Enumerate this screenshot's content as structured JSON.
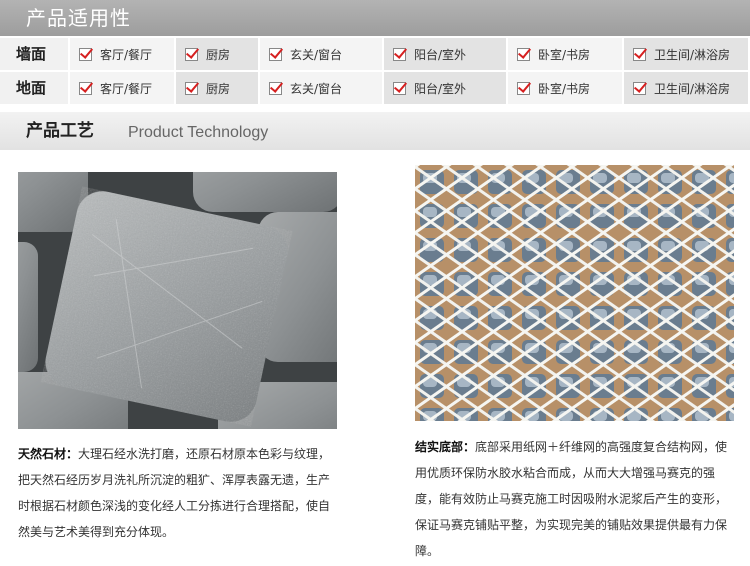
{
  "applicable_title": "产品适用性",
  "rows": [
    {
      "label": "墙面",
      "items": [
        "客厅/餐厅",
        "厨房",
        "玄关/窗台",
        "阳台/室外",
        "卧室/书房",
        "卫生间/淋浴房"
      ]
    },
    {
      "label": "地面",
      "items": [
        "客厅/餐厅",
        "厨房",
        "玄关/窗台",
        "阳台/室外",
        "卧室/书房",
        "卫生间/淋浴房"
      ]
    }
  ],
  "craft": {
    "title_zh": "产品工艺",
    "title_en": "Product Technology"
  },
  "features": [
    {
      "title": "天然石材：",
      "text": "大理石经水洗打磨，还原石材原本色彩与纹理，把天然石经历岁月洗礼所沉淀的粗犷、浑厚表露无遗，生产时根据石材颜色深浅的变化经人工分拣进行合理搭配，使自然美与艺术美得到充分体现。"
    },
    {
      "title": "结实底部：",
      "text": "底部采用纸网＋纤维网的高强度复合结构网，使用优质环保防水胶水粘合而成，从而大大增强马赛克的强度，能有效防止马赛克施工时因吸附水泥浆后产生的变形，保证马赛克铺贴平整，为实现完美的铺贴效果提供最有力保障。"
    }
  ],
  "colors": {
    "check": "#d62020",
    "banner_dark": "#a8a8a8",
    "cell_light": "#f4f4f4",
    "cell_dark": "#e3e3e3"
  }
}
